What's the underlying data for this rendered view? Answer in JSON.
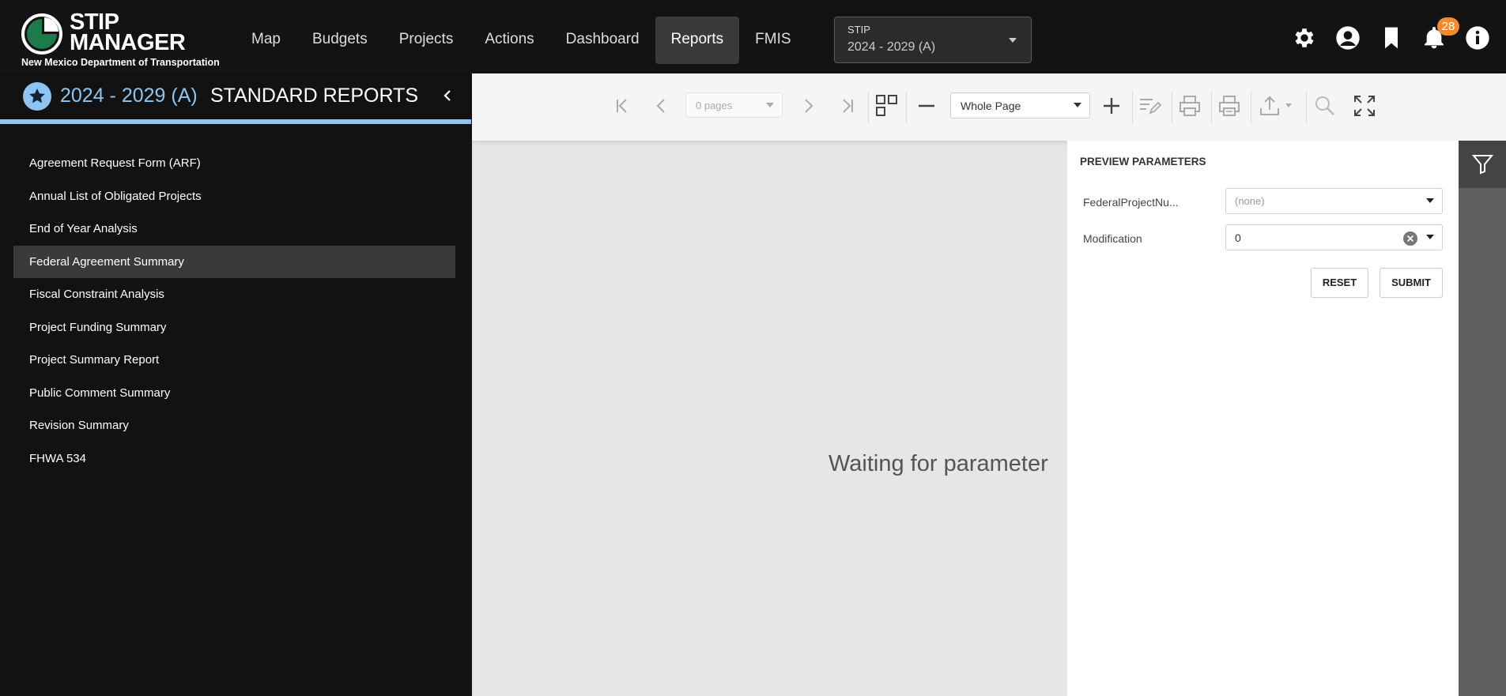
{
  "header": {
    "logo_line1": "STIP",
    "logo_line2": "MANAGER",
    "logo_subtitle": "New Mexico Department of Transportation",
    "nav": [
      "Map",
      "Budgets",
      "Projects",
      "Actions",
      "Dashboard",
      "Reports",
      "FMIS"
    ],
    "active_nav": "Reports",
    "stip_selector": {
      "label": "STIP",
      "value": "2024 - 2029 (A)"
    },
    "notification_count": "28",
    "icons": [
      "gear-icon",
      "user-icon",
      "bookmark-icon",
      "bell-icon",
      "info-icon"
    ]
  },
  "sidebar": {
    "year": "2024 - 2029 (A)",
    "title": "STANDARD REPORTS",
    "reports": [
      "Agreement Request Form (ARF)",
      "Annual List of Obligated Projects",
      "End of Year Analysis",
      "Federal Agreement Summary",
      "Fiscal Constraint Analysis",
      "Project Funding Summary",
      "Project Summary Report",
      "Public Comment Summary",
      "Revision Summary",
      "FHWA 534"
    ],
    "active_report": "Federal Agreement Summary"
  },
  "viewer": {
    "pages_placeholder": "0 pages",
    "zoom": "Whole Page",
    "waiting_text": "Waiting for parameter"
  },
  "parameters": {
    "title": "PREVIEW PARAMETERS",
    "fields": [
      {
        "label": "FederalProjectNu...",
        "value": "(none)"
      },
      {
        "label": "Modification",
        "value": "0"
      }
    ],
    "reset_label": "RESET",
    "submit_label": "SUBMIT"
  },
  "colors": {
    "accent": "#8ec4f2",
    "badge": "#f28a2e",
    "topbar": "#131313"
  }
}
